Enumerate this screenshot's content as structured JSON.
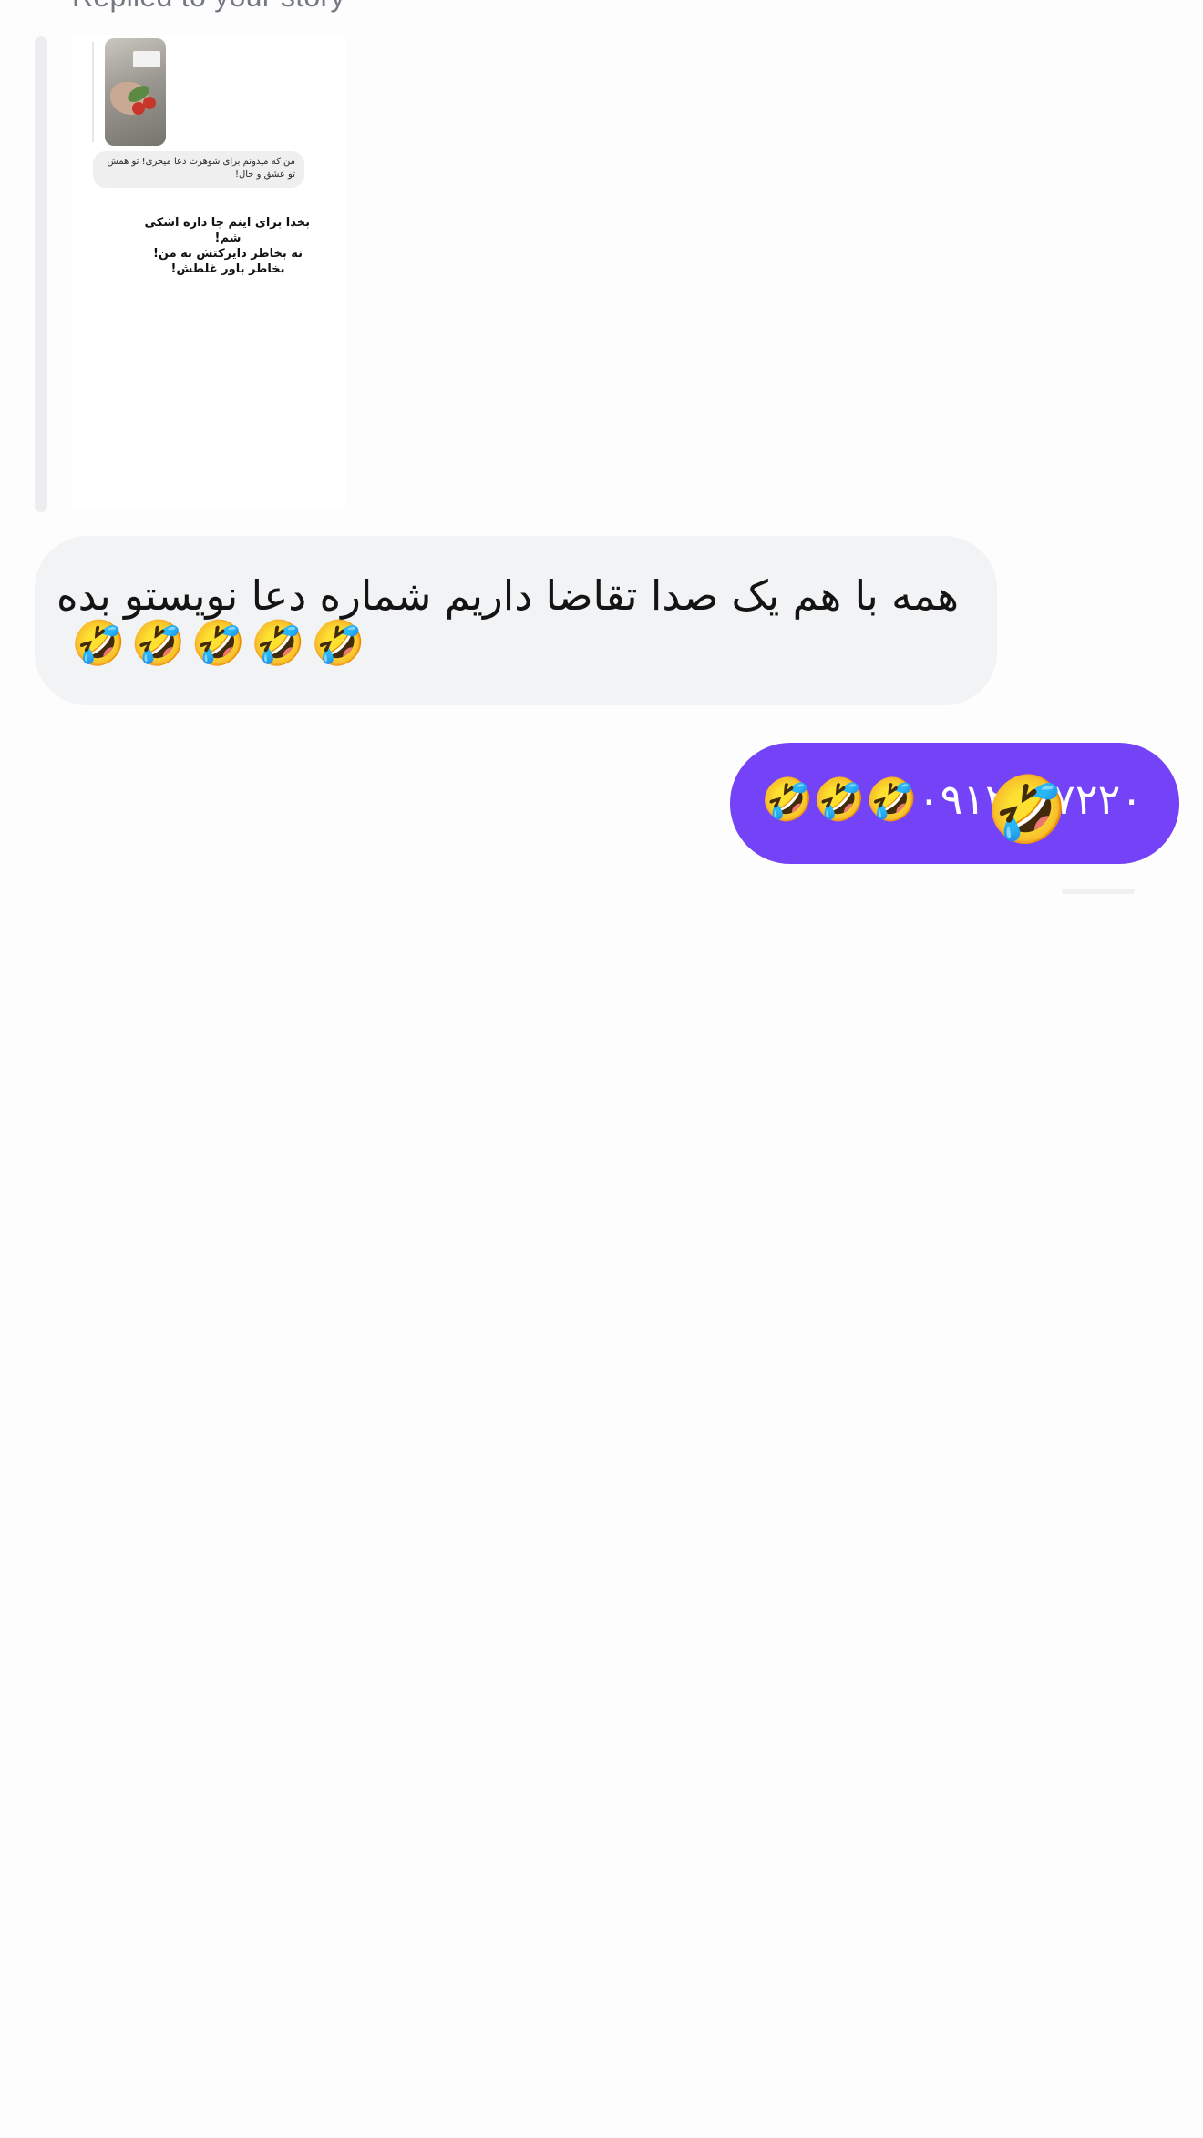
{
  "thread": {
    "replied_label": "Replied to your story"
  },
  "story": {
    "thumbnail_icon": "story-photo-thumbnail",
    "caption": "من که میدونم برای شوهرت دعا میخری! تو همش تو عشق و حال!",
    "quote_lines": [
      "بخدا برای اینم جا داره اشکی",
      "شم!",
      "نه بخاطر دایرکتش به من!",
      "بخاطر باور غلطش!"
    ]
  },
  "messages": {
    "incoming": {
      "text": "همه با هم یک صدا تقاضا داریم شماره دعا نویستو بده",
      "emojis": "🤣🤣🤣🤣🤣"
    },
    "outgoing": {
      "text": "۰۹۱۲۲۸۷۲۲۰🤣🤣🤣",
      "reaction": "🤣"
    }
  },
  "colors": {
    "outgoing_bubble": "#7442f7",
    "incoming_bubble": "#f2f3f5",
    "replied_label": "#737883"
  }
}
